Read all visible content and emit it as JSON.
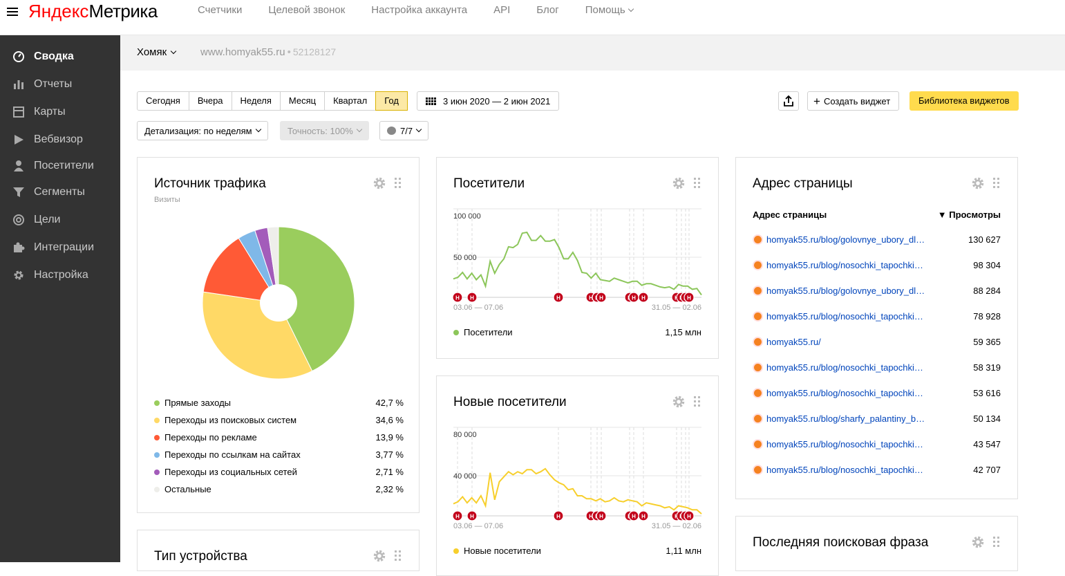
{
  "header": {
    "logo_ya": "Яндекс",
    "logo_rest": "Метрика",
    "nav": [
      "Счетчики",
      "Целевой звонок",
      "Настройка аккаунта",
      "API",
      "Блог"
    ],
    "help": "Помощь"
  },
  "sidebar": {
    "items": [
      {
        "label": "Сводка",
        "icon": "dashboard-icon",
        "active": true
      },
      {
        "label": "Отчеты",
        "icon": "bar-chart-icon"
      },
      {
        "label": "Карты",
        "icon": "map-icon"
      },
      {
        "label": "Вебвизор",
        "icon": "play-icon"
      },
      {
        "label": "Посетители",
        "icon": "user-icon"
      },
      {
        "label": "Сегменты",
        "icon": "filter-icon"
      },
      {
        "label": "Цели",
        "icon": "target-icon"
      },
      {
        "label": "Интеграции",
        "icon": "puzzle-icon"
      },
      {
        "label": "Настройка",
        "icon": "gear-icon"
      }
    ]
  },
  "counter": {
    "name": "Хомяк",
    "site": "www.homyak55.ru",
    "separator": "•",
    "id": "52128127"
  },
  "toolbar": {
    "periods": [
      "Сегодня",
      "Вчера",
      "Неделя",
      "Месяц",
      "Квартал",
      "Год"
    ],
    "active_period": "Год",
    "date_range": "3 июн 2020 — 2 июн 2021",
    "create_widget": "Создать виджет",
    "widget_library": "Библиотека виджетов",
    "detail": "Детализация: по неделям",
    "accuracy": "Точность: 100%",
    "notes": "7/7"
  },
  "widgets": {
    "traffic": {
      "title": "Источник трафика",
      "subtitle": "Визиты",
      "legend": [
        {
          "name": "Прямые заходы",
          "pct": "42,7 %",
          "color": "#9acd5d"
        },
        {
          "name": "Переходы из поисковых систем",
          "pct": "34,6 %",
          "color": "#ffd966"
        },
        {
          "name": "Переходы по рекламе",
          "pct": "13,9 %",
          "color": "#ff5a36"
        },
        {
          "name": "Переходы по ссылкам на сайтах",
          "pct": "3,77 %",
          "color": "#7fb8e8"
        },
        {
          "name": "Переходы из социальных сетей",
          "pct": "2,71 %",
          "color": "#a35cba"
        },
        {
          "name": "Остальные",
          "pct": "2,32 %",
          "color": "#eeeeea"
        }
      ]
    },
    "device": {
      "title": "Тип устройства"
    },
    "visitors": {
      "title": "Посетители",
      "legend_name": "Посетители",
      "total": "1,15 млн",
      "color": "#8cc65a"
    },
    "new_visitors": {
      "title": "Новые посетители",
      "legend_name": "Новые посетители",
      "total": "1,11 млн",
      "color": "#f7cf2c"
    },
    "pages": {
      "title": "Адрес страницы",
      "col1": "Адрес страницы",
      "col2": "▼ Просмотры",
      "rows": [
        {
          "url": "homyak55.ru/blog/golovnye_ubory_dl…",
          "views": "130 627"
        },
        {
          "url": "homyak55.ru/blog/nosochki_tapochki…",
          "views": "98 304"
        },
        {
          "url": "homyak55.ru/blog/golovnye_ubory_dl…",
          "views": "88 284"
        },
        {
          "url": "homyak55.ru/blog/nosochki_tapochki…",
          "views": "78 928"
        },
        {
          "url": "homyak55.ru/",
          "views": "59 365"
        },
        {
          "url": "homyak55.ru/blog/nosochki_tapochki…",
          "views": "58 319"
        },
        {
          "url": "homyak55.ru/blog/nosochki_tapochki…",
          "views": "53 616"
        },
        {
          "url": "homyak55.ru/blog/sharfy_palantiny_b…",
          "views": "50 134"
        },
        {
          "url": "homyak55.ru/blog/nosochki_tapochki…",
          "views": "43 547"
        },
        {
          "url": "homyak55.ru/blog/nosochki_tapochki…",
          "views": "42 707"
        }
      ]
    },
    "search": {
      "title": "Последняя поисковая фраза"
    }
  },
  "chart_data": [
    {
      "type": "pie",
      "title": "Источник трафика",
      "subtitle": "Визиты",
      "categories": [
        "Прямые заходы",
        "Переходы из поисковых систем",
        "Переходы по рекламе",
        "Переходы по ссылкам на сайтах",
        "Переходы из социальных сетей",
        "Остальные"
      ],
      "values": [
        42.7,
        34.6,
        13.9,
        3.77,
        2.71,
        2.32
      ],
      "colors": [
        "#9acd5d",
        "#ffd966",
        "#ff5a36",
        "#7fb8e8",
        "#a35cba",
        "#eeeeea"
      ]
    },
    {
      "type": "line",
      "title": "Посетители",
      "x_start_label": "03.06 — 07.06",
      "x_end_label": "31.05 — 02.06",
      "yticks": [
        "100 000",
        "50 000"
      ],
      "ylim": [
        0,
        100000
      ],
      "series": [
        {
          "name": "Посетители",
          "color": "#8cc65a",
          "values": [
            23000,
            25000,
            31000,
            23000,
            30000,
            22000,
            28000,
            14000,
            45000,
            30000,
            41000,
            48000,
            63000,
            62000,
            66000,
            80000,
            81000,
            71000,
            71000,
            77000,
            70000,
            70000,
            72000,
            62000,
            48000,
            48000,
            56000,
            46000,
            31000,
            30000,
            24000,
            30000,
            22000,
            21000,
            20000,
            24000,
            22000,
            20000,
            18000,
            20000,
            20000,
            15000,
            17000,
            17000,
            15000,
            13000,
            12000,
            13000,
            10000,
            16000,
            14000,
            14000,
            10000,
            11000,
            3000
          ]
        }
      ],
      "note_markers": 13
    },
    {
      "type": "line",
      "title": "Новые посетители",
      "x_start_label": "03.06 — 07.06",
      "x_end_label": "31.05 — 02.06",
      "yticks": [
        "80 000",
        "40 000"
      ],
      "ylim": [
        0,
        80000
      ],
      "series": [
        {
          "name": "Новые посетители",
          "color": "#f7cf2c",
          "values": [
            12000,
            14000,
            19000,
            13000,
            18000,
            13000,
            20000,
            10000,
            43000,
            16000,
            34000,
            39000,
            44000,
            41000,
            44000,
            42000,
            46000,
            46000,
            42000,
            44000,
            47000,
            41000,
            36000,
            33000,
            31000,
            26000,
            27000,
            20000,
            20000,
            17000,
            17000,
            15000,
            17000,
            14000,
            15000,
            18000,
            15000,
            14000,
            16000,
            15000,
            14000,
            10000,
            13000,
            12000,
            11000,
            10000,
            8000,
            9000,
            6000,
            10000,
            9000,
            8000,
            6000,
            6000,
            2000
          ]
        }
      ],
      "note_markers": 13
    }
  ]
}
